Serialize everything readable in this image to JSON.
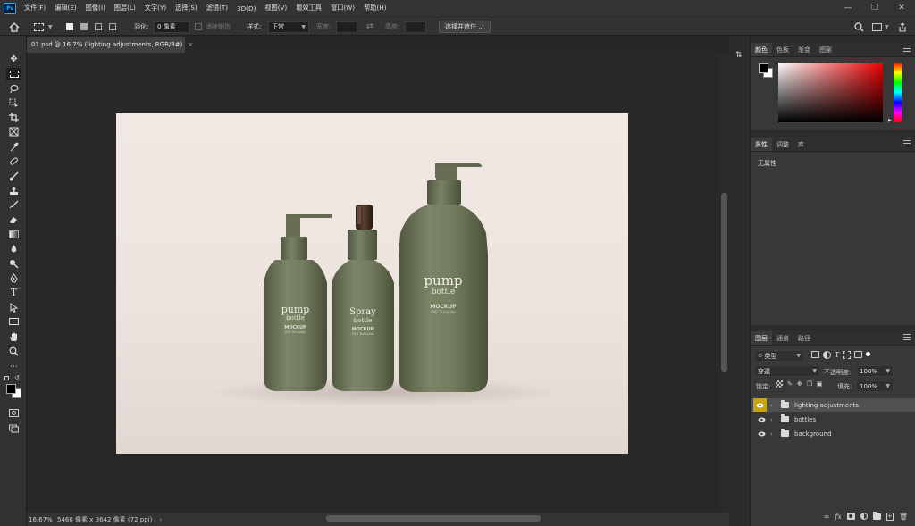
{
  "app": {
    "logo": "Ps"
  },
  "menu": [
    "文件(F)",
    "编辑(E)",
    "图像(I)",
    "图层(L)",
    "文字(Y)",
    "选择(S)",
    "滤镜(T)",
    "3D(D)",
    "视图(V)",
    "增效工具",
    "窗口(W)",
    "帮助(H)"
  ],
  "options": {
    "feather_label": "羽化:",
    "feather_value": "0 像素",
    "antialias_label": "消除锯齿",
    "style_label": "样式:",
    "style_value": "正常",
    "width_label": "宽度:",
    "height_label": "高度:",
    "select_mask_button": "选择并遮住 ..."
  },
  "document": {
    "tab_title": "01.psd @ 16.7% (lighting adjustments, RGB/8#)",
    "zoom": "16.67%",
    "info": "5460 像素 x 3642 像素 (72 ppi)"
  },
  "mockup": {
    "left": {
      "title": "pump",
      "sub": "bottle",
      "brand": "MOCKUP",
      "small": "PSD Template"
    },
    "mid": {
      "title": "Spray",
      "sub": "bottle",
      "brand": "MOCKUP",
      "small": "PSD Template"
    },
    "right": {
      "title": "pump",
      "sub": "bottle",
      "brand": "MOCKUP",
      "small": "PSD Template"
    }
  },
  "color_panel": {
    "tabs": [
      "颜色",
      "色板",
      "渐变",
      "图案"
    ],
    "active": 0
  },
  "properties_panel": {
    "tabs": [
      "属性",
      "调整",
      "库"
    ],
    "active": 0,
    "empty_text": "无属性"
  },
  "layers_panel": {
    "tabs": [
      "图层",
      "通道",
      "路径"
    ],
    "active": 0,
    "filter_label": "类型",
    "blend_mode": "穿透",
    "opacity_label": "不透明度:",
    "opacity_value": "100%",
    "lock_label": "锁定:",
    "fill_label": "填充:",
    "fill_value": "100%",
    "layers": [
      {
        "name": "lighting adjustments",
        "selected": true
      },
      {
        "name": "bottles",
        "selected": false
      },
      {
        "name": "background",
        "selected": false
      }
    ]
  },
  "colors": {
    "accent_eye": "#c8a30b",
    "bottle": "#727a5c",
    "selected_layer": "#505050"
  }
}
